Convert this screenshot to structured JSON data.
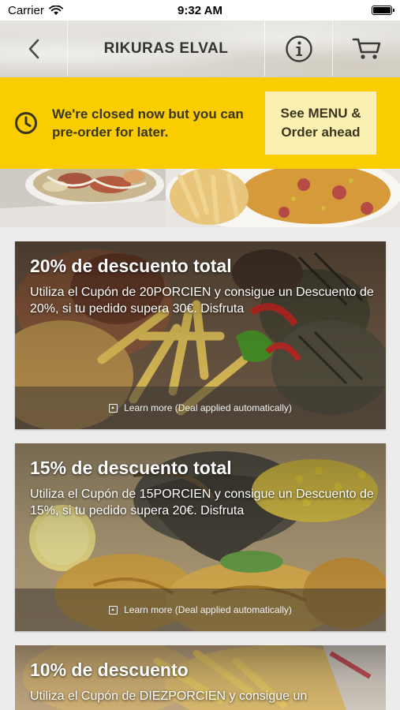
{
  "status_bar": {
    "carrier": "Carrier",
    "time": "9:32 AM"
  },
  "nav": {
    "title": "RIKURAS ELVAL",
    "back_icon": "chevron-left-icon",
    "info_icon": "info-icon",
    "cart_icon": "cart-icon"
  },
  "closed_banner": {
    "message": "We're closed now but you can pre-order for later.",
    "button_label": "See MENU & Order ahead",
    "icon": "clock-icon",
    "bg_color": "#f9cd00"
  },
  "deals": [
    {
      "title": "20% de descuento total",
      "description": "Utiliza el Cupón de 20PORCIEN y consigue un Descuento de 20%, si tu pedido supera 30€. Disfruta",
      "footer": "Learn more (Deal applied automatically)"
    },
    {
      "title": "15% de descuento total",
      "description": "Utiliza el Cupón de 15PORCIEN y consigue un Descuento de 15%, si tu pedido supera 20€. Disfruta",
      "footer": "Learn more (Deal applied automatically)"
    },
    {
      "title": "10% de descuento",
      "description": "Utiliza el Cupón de DIEZPORCIEN y consigue un",
      "footer": ""
    }
  ]
}
